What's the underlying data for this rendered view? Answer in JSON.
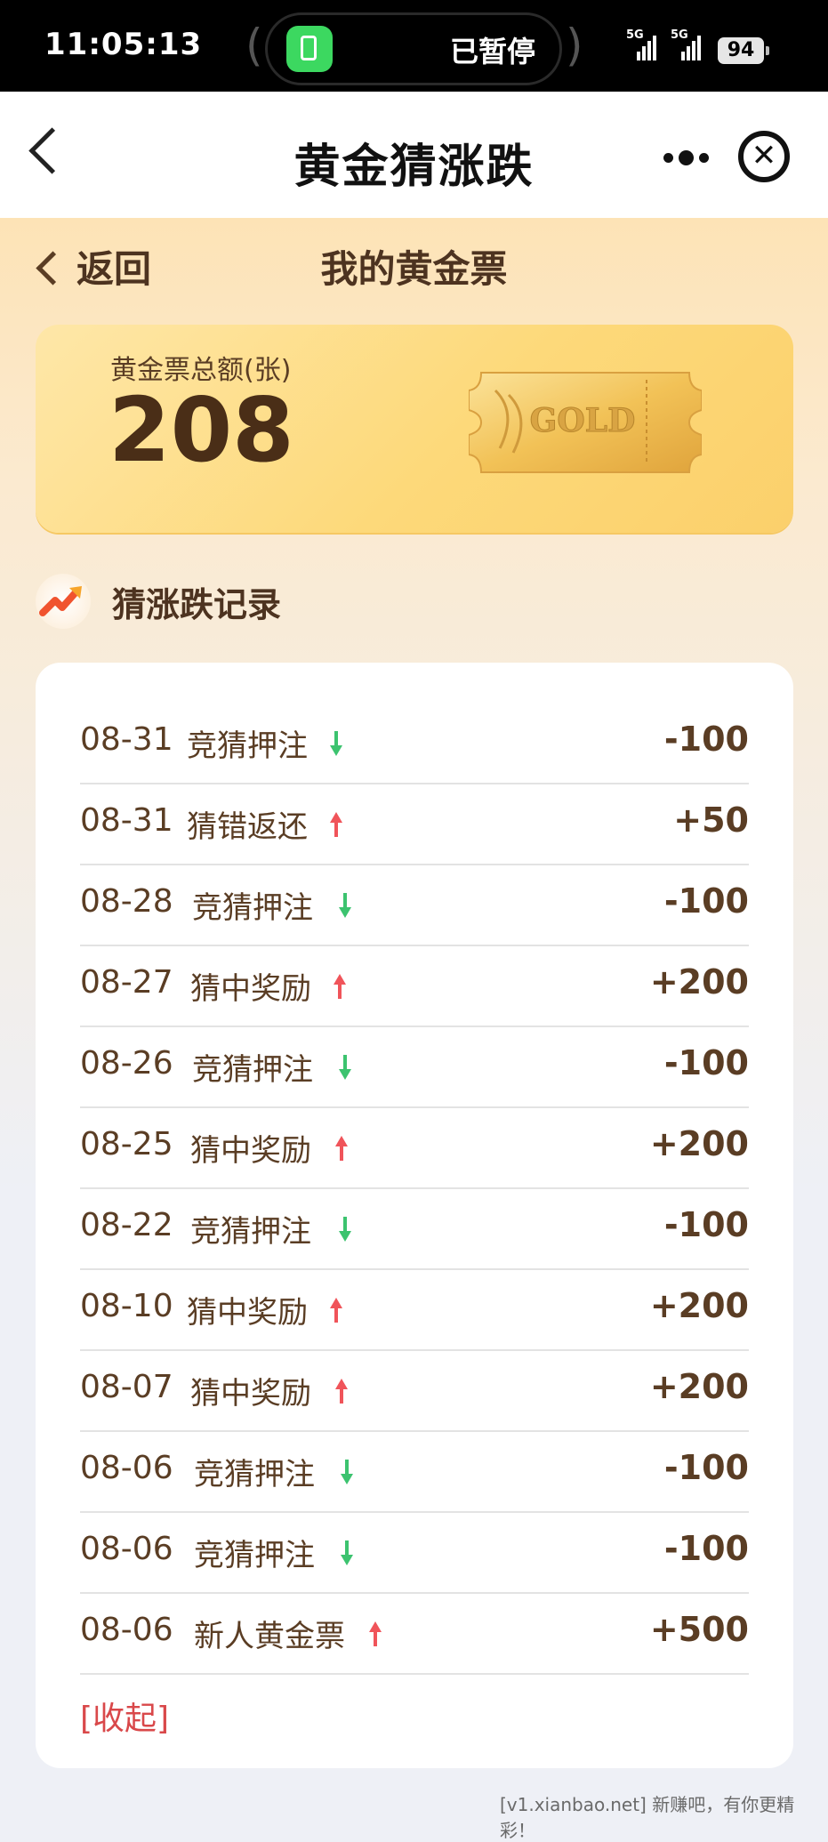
{
  "status_bar": {
    "time": "11:05:13",
    "paused_label": "已暂停",
    "signal_1": "5G",
    "signal_2": "5G",
    "battery": "94"
  },
  "nav": {
    "title": "黄金猜涨跌"
  },
  "sub_header": {
    "back_label": "返回",
    "title": "我的黄金票"
  },
  "summary": {
    "label": "黄金票总额(张)",
    "value": "208",
    "ticket_text": "GOLD"
  },
  "records": {
    "title": "猜涨跌记录",
    "columns": [
      "date",
      "type",
      "direction",
      "amount"
    ],
    "items": [
      {
        "date": "08-31",
        "type": "竞猜押注",
        "direction": "down",
        "amount": "-100"
      },
      {
        "date": "08-31",
        "type": "猜错返还",
        "direction": "up",
        "amount": "+50"
      },
      {
        "date": "08-28",
        "type": "竞猜押注",
        "direction": "down",
        "amount": "-100"
      },
      {
        "date": "08-27",
        "type": "猜中奖励",
        "direction": "up",
        "amount": "+200"
      },
      {
        "date": "08-26",
        "type": "竞猜押注",
        "direction": "down",
        "amount": "-100"
      },
      {
        "date": "08-25",
        "type": "猜中奖励",
        "direction": "up",
        "amount": "+200"
      },
      {
        "date": "08-22",
        "type": "竞猜押注",
        "direction": "down",
        "amount": "-100"
      },
      {
        "date": "08-10",
        "type": "猜中奖励",
        "direction": "up",
        "amount": "+200"
      },
      {
        "date": "08-07",
        "type": "猜中奖励",
        "direction": "up",
        "amount": "+200"
      },
      {
        "date": "08-06",
        "type": "竞猜押注",
        "direction": "down",
        "amount": "-100"
      },
      {
        "date": "08-06",
        "type": "竞猜押注",
        "direction": "down",
        "amount": "-100"
      },
      {
        "date": "08-06",
        "type": "新人黄金票",
        "direction": "up",
        "amount": "+500"
      }
    ],
    "collapse_label": "[收起]"
  },
  "colors": {
    "up_arrow": "#f0545a",
    "down_arrow": "#3cc36f",
    "text_brown": "#5a3d24",
    "collapse_red": "#d9484a"
  },
  "watermark": "[v1.xianbao.net] 新赚吧，有你更精彩！"
}
